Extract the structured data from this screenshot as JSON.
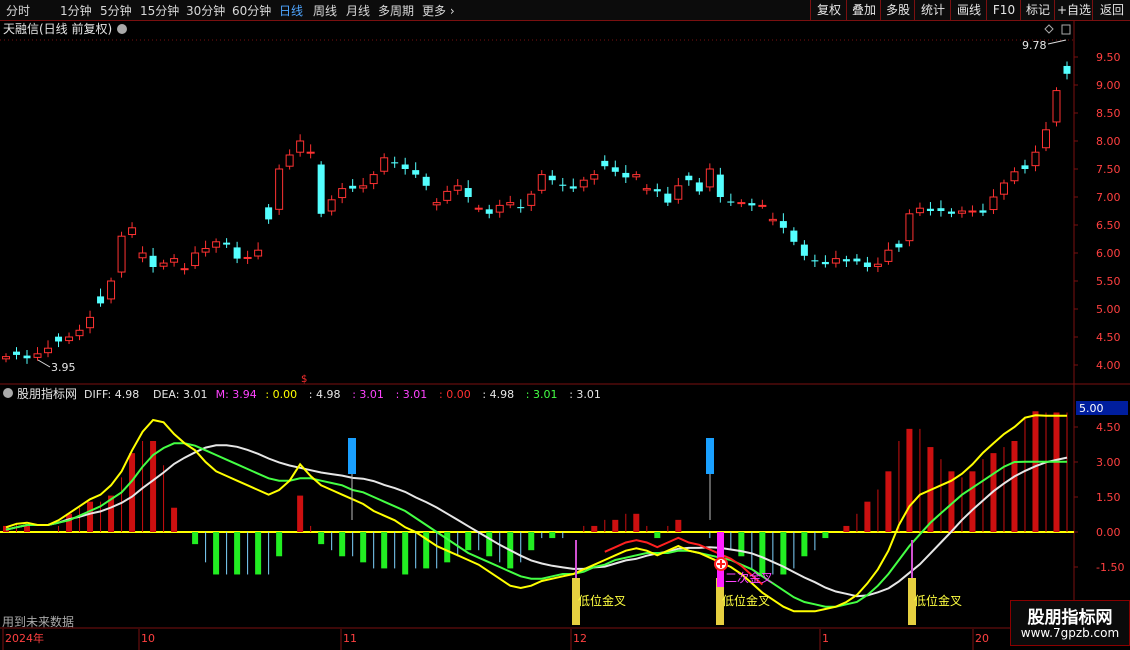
{
  "toolbar": {
    "timeframes": [
      "分时",
      "1分钟",
      "5分钟",
      "15分钟",
      "30分钟",
      "60分钟",
      "日线",
      "周线",
      "月线",
      "多周期",
      "更多"
    ],
    "active": "日线",
    "right_buttons": [
      "复权",
      "叠加",
      "多股",
      "统计",
      "画线",
      "F10",
      "标记",
      "+自选",
      "返回"
    ]
  },
  "main_panel": {
    "title": "天融信(日线 前复权)",
    "price_labels": [
      "9.50",
      "9.00",
      "8.50",
      "8.00",
      "7.50",
      "7.00",
      "6.50",
      "6.00",
      "5.50",
      "5.00",
      "4.50",
      "4.00"
    ],
    "high_label": "9.78",
    "low_label": "3.95",
    "marker": "$"
  },
  "indicator_panel": {
    "name": "股朋指标网",
    "values": [
      {
        "text": "DIFF: 4.98",
        "color": "#e6e6e6"
      },
      {
        "text": "DEA: 3.01",
        "color": "#e6e6e6"
      },
      {
        "text": "M: 3.94",
        "color": "#ff44ff"
      },
      {
        "text": ": 0.00",
        "color": "#ffff00"
      },
      {
        "text": ": 4.98",
        "color": "#e6e6e6"
      },
      {
        "text": ": 3.01",
        "color": "#ff44ff"
      },
      {
        "text": ": 3.01",
        "color": "#ff44ff"
      },
      {
        "text": ": 0.00",
        "color": "#ff3030"
      },
      {
        "text": ": 4.98",
        "color": "#e6e6e6"
      },
      {
        "text": ": 3.01",
        "color": "#44ff44"
      },
      {
        "text": ": 3.01",
        "color": "#e6e6e6"
      }
    ],
    "axis_labels": [
      "4.50",
      "3.00",
      "1.50",
      "0.00",
      "-1.50"
    ],
    "current_value": "5.00",
    "annotations": [
      "低位金叉",
      "低位金叉",
      "二次金叉",
      "低位金叉"
    ],
    "footer_note": "用到未来数据"
  },
  "date_axis": {
    "labels": [
      "2024年",
      "10",
      "11",
      "12",
      "1",
      "20"
    ]
  },
  "watermark": {
    "line1": "股朋指标网",
    "line2": "www.7gpzb.com"
  },
  "colors": {
    "up": "#ff3232",
    "down": "#54ffff",
    "grid": "#7a1010",
    "diff": "#ffff00",
    "dea": "#44ff44",
    "white_line": "#e6e6e6"
  }
}
